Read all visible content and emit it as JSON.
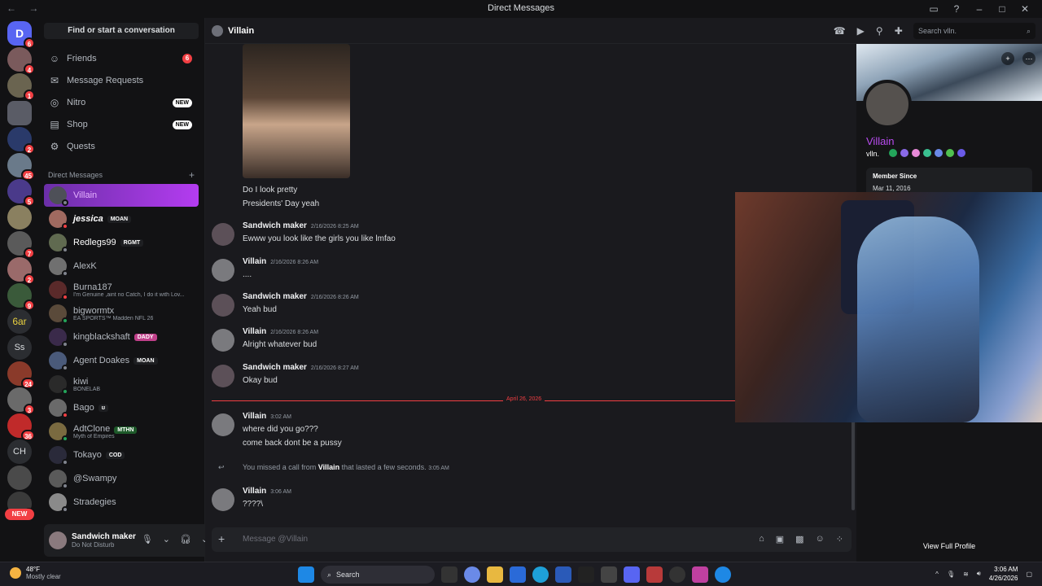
{
  "window": {
    "title": "Direct Messages",
    "nav": "← →"
  },
  "server_rail": {
    "home_label": "D",
    "badges": [
      "6",
      "4",
      "1",
      "2",
      "45",
      "5",
      "7",
      "7",
      "2",
      "9",
      "24",
      "3",
      "36",
      "63",
      "5"
    ],
    "text_servers": [
      "6ar",
      "Ss",
      "CH"
    ],
    "new_label": "NEW"
  },
  "sidebar": {
    "find_label": "Find or start a conversation",
    "nav": [
      {
        "label": "Friends",
        "icon": "friends-icon",
        "count": "6"
      },
      {
        "label": "Message Requests",
        "icon": "mail-icon"
      },
      {
        "label": "Nitro",
        "icon": "nitro-icon",
        "tag": "NEW"
      },
      {
        "label": "Shop",
        "icon": "shop-icon",
        "tag": "NEW"
      },
      {
        "label": "Quests",
        "icon": "quests-icon"
      }
    ],
    "dm_header": "Direct Messages",
    "dms": [
      {
        "name": "Villain",
        "active": true,
        "status": "offline"
      },
      {
        "name": "jessica",
        "tag": "MOAN",
        "status": "dnd"
      },
      {
        "name": "Redlegs99",
        "tag": "RGMT",
        "status": "offline"
      },
      {
        "name": "AlexK",
        "status": "offline"
      },
      {
        "name": "Burna187",
        "sub": "I'm Genuine ,aint no Catch, I do it with Lov...",
        "status": "dnd"
      },
      {
        "name": "bigwormtx",
        "sub": "EA SPORTS™ Madden NFL 26",
        "status": "online"
      },
      {
        "name": "kingblackshaft",
        "tag": "DADY",
        "status": "offline"
      },
      {
        "name": "Agent Doakes",
        "tag": "MOAN",
        "status": "offline"
      },
      {
        "name": "kiwi",
        "sub": "BONELAB",
        "status": "online"
      },
      {
        "name": "Bago",
        "tag": "ʊ",
        "status": "dnd"
      },
      {
        "name": "AdtClone",
        "tag": "MTHN",
        "sub": "Myth of Empires",
        "status": "online"
      },
      {
        "name": "Tokayo",
        "tag": "COD",
        "status": "offline"
      },
      {
        "name": "@Swampy",
        "status": "offline"
      },
      {
        "name": "Stradegies",
        "status": "offline"
      }
    ]
  },
  "user_panel": {
    "name": "Sandwich maker",
    "status": "Do Not Disturb"
  },
  "chat": {
    "channel_name": "Villain",
    "search_placeholder": "Search vlln.",
    "pre_lines": [
      "Do I look pretty",
      "Presidents' Day yeah"
    ],
    "messages": [
      {
        "author": "Sandwich maker",
        "time": "2/16/2026 8:25 AM",
        "text": "Ewww you look like the girls you like lmfao"
      },
      {
        "author": "Villain",
        "time": "2/16/2026 8:26 AM",
        "text": "...."
      },
      {
        "author": "Sandwich maker",
        "time": "2/16/2026 8:26 AM",
        "text": "Yeah bud"
      },
      {
        "author": "Villain",
        "time": "2/16/2026 8:26 AM",
        "text": "Alright whatever bud"
      },
      {
        "author": "Sandwich maker",
        "time": "2/16/2026 8:27 AM",
        "text": "Okay bud"
      }
    ],
    "date_divider": "April 26, 2026",
    "later_messages": [
      {
        "author": "Villain",
        "time": "3:02 AM",
        "text": "where did you go???",
        "text2": "come back dont be a pussy"
      }
    ],
    "missed_call": {
      "prefix": "You missed a call from",
      "who": "Villain",
      "suffix": "that lasted a few seconds.",
      "time": "3:05 AM"
    },
    "last_message": {
      "author": "Villain",
      "time": "3:06 AM",
      "text": "????\\"
    },
    "composer_placeholder": "Message @Villain"
  },
  "profile": {
    "display_name": "Villain",
    "username": "vlln.",
    "member_since_label": "Member Since",
    "member_since": "Mar 11, 2016",
    "view_full": "View Full Profile",
    "name_color": "#b94cf0"
  },
  "taskbar": {
    "temp": "48°F",
    "weather": "Mostly clear",
    "search": "Search",
    "time": "3:06 AM",
    "date": "4/26/2026"
  }
}
